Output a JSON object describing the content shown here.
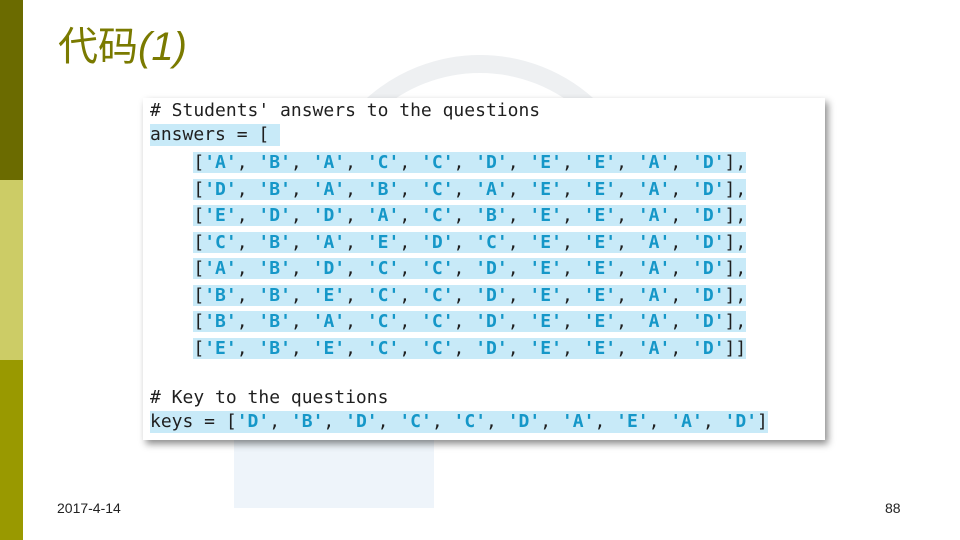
{
  "slide": {
    "title_main": "代码",
    "title_suffix": "(1)",
    "date": "2017-4-14",
    "page_number": "88"
  },
  "code": {
    "comment_answers": "# Students' answers to the questions",
    "answers_decl": "answers = [",
    "answer_rows": [
      [
        "A",
        "B",
        "A",
        "C",
        "C",
        "D",
        "E",
        "E",
        "A",
        "D"
      ],
      [
        "D",
        "B",
        "A",
        "B",
        "C",
        "A",
        "E",
        "E",
        "A",
        "D"
      ],
      [
        "E",
        "D",
        "D",
        "A",
        "C",
        "B",
        "E",
        "E",
        "A",
        "D"
      ],
      [
        "C",
        "B",
        "A",
        "E",
        "D",
        "C",
        "E",
        "E",
        "A",
        "D"
      ],
      [
        "A",
        "B",
        "D",
        "C",
        "C",
        "D",
        "E",
        "E",
        "A",
        "D"
      ],
      [
        "B",
        "B",
        "E",
        "C",
        "C",
        "D",
        "E",
        "E",
        "A",
        "D"
      ],
      [
        "B",
        "B",
        "A",
        "C",
        "C",
        "D",
        "E",
        "E",
        "A",
        "D"
      ],
      [
        "E",
        "B",
        "E",
        "C",
        "C",
        "D",
        "E",
        "E",
        "A",
        "D"
      ]
    ],
    "comment_keys": "# Key to the questions",
    "keys_decl": "keys = ",
    "keys": [
      "D",
      "B",
      "D",
      "C",
      "C",
      "D",
      "A",
      "E",
      "A",
      "D"
    ]
  },
  "colors": {
    "bar_dark": "#6b6b00",
    "bar_light": "#cccc66",
    "bar_mid": "#999900",
    "title": "#7a7a00",
    "string_literal": "#1597c8",
    "highlight": "#c8eaf8"
  }
}
